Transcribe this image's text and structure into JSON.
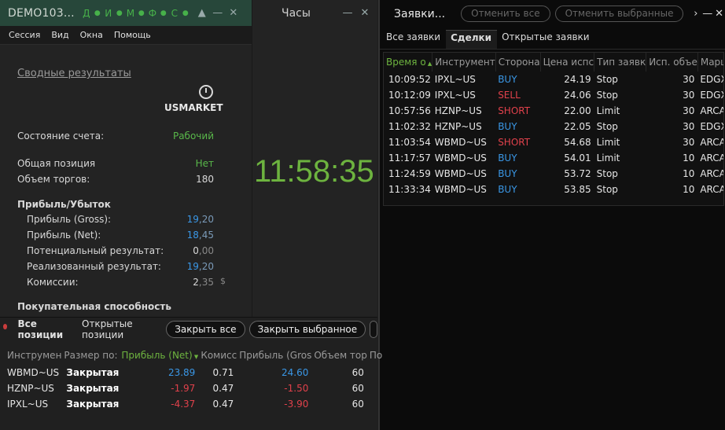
{
  "left_window": {
    "title": "DEMO103...",
    "title_icons": [
      "Д",
      "И",
      "М",
      "Ф",
      "С"
    ],
    "menu": [
      "Сессия",
      "Вид",
      "Окна",
      "Помощь"
    ]
  },
  "summary": {
    "link": "Сводные результаты",
    "market": "USMARKET",
    "account_state_label": "Состояние счета:",
    "account_state_value": "Рабочий",
    "total_position_label": "Общая позиция",
    "total_position_value": "Нет",
    "volume_label": "Объем торгов:",
    "volume_value": "180",
    "pnl_header": "Прибыль/Убыток",
    "gross_label": "Прибыль (Gross):",
    "gross_int": "19",
    "gross_dec": ",20",
    "net_label": "Прибыль (Net):",
    "net_int": "18",
    "net_dec": ",45",
    "potential_label": "Потенциальный результат:",
    "potential_int": "0",
    "potential_dec": ",00",
    "realized_label": "Реализованный результат:",
    "realized_int": "19",
    "realized_dec": ",20",
    "commission_label": "Комиссии:",
    "commission_int": "2",
    "commission_dec": ",35",
    "currency": "$",
    "buying_power_header": "Покупательная способность"
  },
  "clock_window": {
    "title": "Часы",
    "time": "11:58:35"
  },
  "orders_window": {
    "title": "Заявки...",
    "cancel_all": "Отменить все",
    "cancel_selected": "Отменить выбранные",
    "more": "›",
    "tabs": [
      "Все заявки",
      "Сделки",
      "Открытые заявки"
    ],
    "columns": [
      "Время о",
      "Инструмент",
      "Сторона",
      "Цена испс",
      "Тип заявк",
      "Исп. объе",
      "Маршр"
    ],
    "rows": [
      {
        "time": "10:09:52",
        "symbol": "IPXL~US",
        "side": "BUY",
        "price": "24.19",
        "type": "Stop",
        "qty": "30",
        "route": "EDGX"
      },
      {
        "time": "10:12:09",
        "symbol": "IPXL~US",
        "side": "SELL",
        "price": "24.06",
        "type": "Stop",
        "qty": "30",
        "route": "EDGX"
      },
      {
        "time": "10:57:56",
        "symbol": "HZNP~US",
        "side": "SHORT",
        "price": "22.00",
        "type": "Limit",
        "qty": "30",
        "route": "ARCA"
      },
      {
        "time": "11:02:32",
        "symbol": "HZNP~US",
        "side": "BUY",
        "price": "22.05",
        "type": "Stop",
        "qty": "30",
        "route": "EDGX"
      },
      {
        "time": "11:03:54",
        "symbol": "WBMD~US",
        "side": "SHORT",
        "price": "54.68",
        "type": "Limit",
        "qty": "30",
        "route": "ARCA"
      },
      {
        "time": "11:17:57",
        "symbol": "WBMD~US",
        "side": "BUY",
        "price": "54.01",
        "type": "Limit",
        "qty": "10",
        "route": "ARCA"
      },
      {
        "time": "11:24:59",
        "symbol": "WBMD~US",
        "side": "BUY",
        "price": "53.72",
        "type": "Stop",
        "qty": "10",
        "route": "ARCA"
      },
      {
        "time": "11:33:34",
        "symbol": "WBMD~US",
        "side": "BUY",
        "price": "53.85",
        "type": "Stop",
        "qty": "10",
        "route": "ARCA"
      }
    ]
  },
  "positions_window": {
    "tabs": [
      "Все позиции",
      "Открытые позиции"
    ],
    "close_all": "Закрыть все",
    "close_selected": "Закрыть выбранное",
    "columns": [
      "Инструмен",
      "Размер по:",
      "Прибыль (Net)",
      "Комисс",
      "Прибыль (Gros",
      "Объем тор",
      "По"
    ],
    "rows": [
      {
        "symbol": "WBMD~US",
        "size": "Закрытая",
        "net": "23.89",
        "commission": "0.71",
        "gross": "24.60",
        "volume": "60"
      },
      {
        "symbol": "HZNP~US",
        "size": "Закрытая",
        "net": "-1.97",
        "commission": "0.47",
        "gross": "-1.50",
        "volume": "60"
      },
      {
        "symbol": "IPXL~US",
        "size": "Закрытая",
        "net": "-4.37",
        "commission": "0.47",
        "gross": "-3.90",
        "volume": "60"
      }
    ]
  },
  "colors": {
    "accent_green": "#6db33f",
    "buy_blue": "#3a97e6",
    "sell_red": "#e0414b",
    "title_green": "#27473a"
  }
}
